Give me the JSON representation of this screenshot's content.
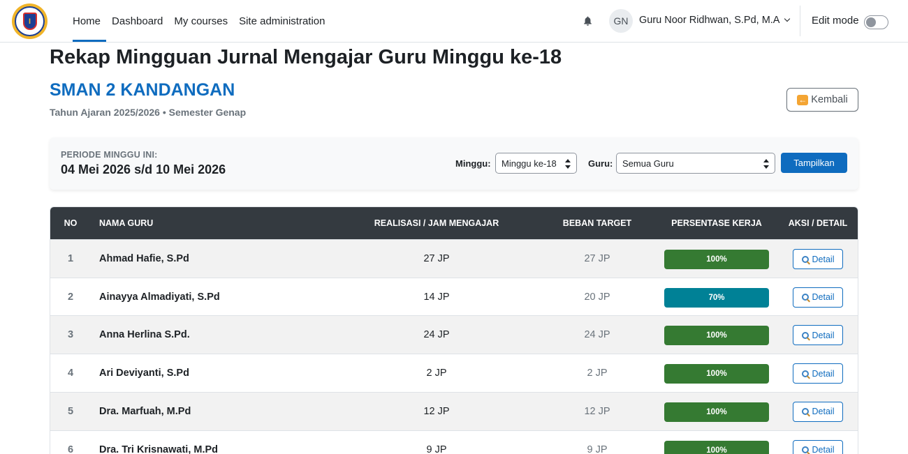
{
  "navbar": {
    "logo_icon": "school-crest-icon",
    "links": [
      {
        "label": "Home",
        "active": true
      },
      {
        "label": "Dashboard",
        "active": false
      },
      {
        "label": "My courses",
        "active": false
      },
      {
        "label": "Site administration",
        "active": false
      }
    ],
    "notification_icon": "bell-icon",
    "user_initials": "GN",
    "user_name": "Guru Noor Ridhwan, S.Pd, M.A",
    "edit_mode_label": "Edit mode",
    "edit_mode_on": false
  },
  "header": {
    "title": "Rekap Mingguan Jurnal Mengajar Guru Minggu ke-18",
    "school": "SMAN 2 KANDANGAN",
    "academic_year": "Tahun Ajaran 2025/2026 • Semester Genap",
    "back_label": "Kembali",
    "back_icon": "left-arrow-icon"
  },
  "filter": {
    "period_label": "PERIODE MINGGU INI:",
    "period_value": "04 Mei 2026 s/d 10 Mei 2026",
    "week_label": "Minggu:",
    "week_value": "Minggu ke-18",
    "teacher_label": "Guru:",
    "teacher_value": "Semua Guru",
    "submit_label": "Tampilkan"
  },
  "table": {
    "headers": [
      "NO",
      "NAMA GURU",
      "REALISASI / JAM MENGAJAR",
      "BEBAN TARGET",
      "PERSENTASE KERJA",
      "AKSI / DETAIL"
    ],
    "detail_label": "Detail",
    "detail_icon": "magnifier-icon",
    "rows": [
      {
        "no": "1",
        "name": "Ahmad Hafie, S.Pd",
        "realisasi": "27 JP",
        "target": "27 JP",
        "percent": "100%",
        "color": "#357a32"
      },
      {
        "no": "2",
        "name": "Ainayya Almadiyati, S.Pd",
        "realisasi": "14 JP",
        "target": "20 JP",
        "percent": "70%",
        "color": "#008196"
      },
      {
        "no": "3",
        "name": "Anna Herlina S.Pd.",
        "realisasi": "24 JP",
        "target": "24 JP",
        "percent": "100%",
        "color": "#357a32"
      },
      {
        "no": "4",
        "name": "Ari Deviyanti, S.Pd",
        "realisasi": "2 JP",
        "target": "2 JP",
        "percent": "100%",
        "color": "#357a32"
      },
      {
        "no": "5",
        "name": "Dra. Marfuah, M.Pd",
        "realisasi": "12 JP",
        "target": "12 JP",
        "percent": "100%",
        "color": "#357a32"
      },
      {
        "no": "6",
        "name": "Dra. Tri Krisnawati, M.Pd",
        "realisasi": "9 JP",
        "target": "9 JP",
        "percent": "100%",
        "color": "#357a32"
      }
    ]
  },
  "colors": {
    "accent": "#0f6cbf",
    "table_header": "#343a40",
    "success": "#357a32",
    "info": "#008196"
  }
}
